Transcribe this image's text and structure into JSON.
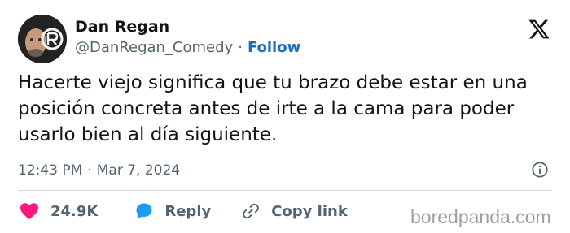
{
  "author": {
    "name": "Dan Regan",
    "handle": "@DanRegan_Comedy",
    "separator": "·",
    "follow_label": "Follow",
    "avatar_icon": "profile-photo-with-logo"
  },
  "platform_icon": "x-logo-icon",
  "tweet": {
    "text": "Hacerte viejo significa que tu brazo debe estar en una posición concreta antes de irte a la cama para poder usarlo bien al día siguiente."
  },
  "timestamp": {
    "time": "12:43 PM",
    "separator": "·",
    "date": "Mar 7, 2024"
  },
  "actions": {
    "likes": {
      "icon": "heart-icon",
      "count": "24.9K",
      "color": "#f91880"
    },
    "reply": {
      "icon": "speech-bubble-icon",
      "label": "Reply",
      "color": "#1d9bf0"
    },
    "copy_link": {
      "icon": "link-icon",
      "label": "Copy link"
    }
  },
  "watermark": "boredpanda.com",
  "colors": {
    "text": "#0f1419",
    "secondary": "#536471",
    "follow": "#1d6fb8",
    "divider": "#cfd9de"
  }
}
